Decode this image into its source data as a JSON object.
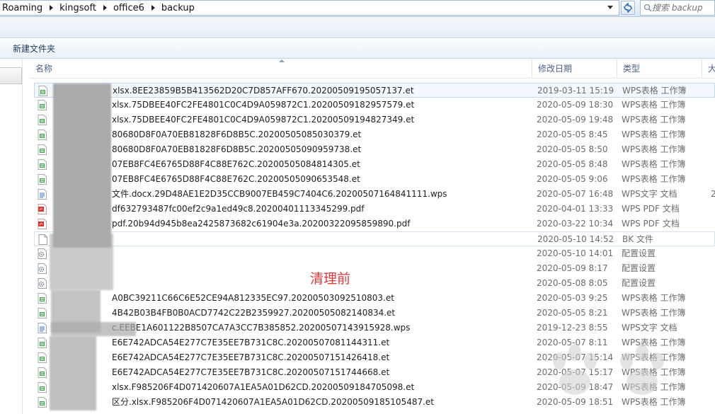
{
  "address": {
    "crumbs": [
      "Roaming",
      "kingsoft",
      "office6",
      "backup"
    ],
    "search_placeholder": "搜索 backup"
  },
  "toolbar": {
    "new_folder_label": "新建文件夹"
  },
  "columns": {
    "name": "名称",
    "date": "修改日期",
    "type": "类型",
    "size": "大"
  },
  "annotation": "清理前",
  "colors": {
    "annotation": "#e23a3a",
    "selection": "#f3f8fe",
    "header_text": "#4d6185"
  },
  "files": [
    {
      "icon": "wps-et-icon",
      "name": "xlsx.8EE23859B5B413562D20C7D857AFF670.20200509195057137.et",
      "date": "2019-03-11 15:19",
      "type": "WPS表格 工作簿",
      "size": ""
    },
    {
      "icon": "wps-et-icon",
      "name": "xlsx.75DBEE40FC2FE4801C0C4D9A059872C1.20200509182957579.et",
      "date": "2020-05-09 18:30",
      "type": "WPS表格 工作簿",
      "size": ""
    },
    {
      "icon": "wps-et-icon",
      "name": "xlsx.75DBEE40FC2FE4801C0C4D9A059872C1.20200509194827349.et",
      "date": "2020-05-09 19:48",
      "type": "WPS表格 工作簿",
      "size": ""
    },
    {
      "icon": "wps-et-icon",
      "name": "80680D8F0A70EB81828F6D8B5C.20200505085030379.et",
      "date": "2020-05-05 8:45",
      "type": "WPS表格 工作簿",
      "size": ""
    },
    {
      "icon": "wps-et-icon",
      "name": "80680D8F0A70EB81828F6D8B5C.20200505090959738.et",
      "date": "2020-05-05 8:50",
      "type": "WPS表格 工作簿",
      "size": ""
    },
    {
      "icon": "wps-et-icon",
      "name": "07EB8FC4E6765D88F4C88E762C.20200505084814305.et",
      "date": "2020-05-05 8:48",
      "type": "WPS表格 工作簿",
      "size": ""
    },
    {
      "icon": "wps-et-icon",
      "name": "07EB8FC4E6765D88F4C88E762C.20200505090653548.et",
      "date": "2020-05-05 9:06",
      "type": "WPS表格 工作簿",
      "size": ""
    },
    {
      "icon": "wps-doc-icon",
      "name": "文件.docx.29D48AE1E2D35CCB9007EB459C7404C6.20200507164841111.wps",
      "date": "2020-05-07 16:48",
      "type": "WPS文字 文档",
      "size": "2"
    },
    {
      "icon": "pdf-icon",
      "name": "df632793487fc00ef2c9a1ed49c8.20200401113345299.pdf",
      "date": "2020-04-01 13:33",
      "type": "WPS PDF 文档",
      "size": ""
    },
    {
      "icon": "pdf-icon",
      "name": "pdf.20b94d945b8ea2425873682c61904e3a.20200322095859890.pdf",
      "date": "2020-03-22 10:34",
      "type": "WPS PDF 文档",
      "size": ""
    },
    {
      "icon": "blank-file-icon",
      "name": "",
      "date": "2020-05-10 14:52",
      "type": "BK 文件",
      "size": ""
    },
    {
      "icon": "config-icon",
      "name": "",
      "date": "2020-05-10 14:01",
      "type": "配置设置",
      "size": ""
    },
    {
      "icon": "config-icon",
      "name": "",
      "date": "2020-05-09 8:17",
      "type": "配置设置",
      "size": ""
    },
    {
      "icon": "config-icon",
      "name": "",
      "date": "2020-05-08 8:05",
      "type": "配置设置",
      "size": ""
    },
    {
      "icon": "wps-et-icon",
      "name": "A0BC39211C66C6E52CE94A812335EC97.20200503092510803.et",
      "date": "2020-05-03 9:25",
      "type": "WPS表格 工作簿",
      "size": ""
    },
    {
      "icon": "wps-et-icon",
      "name": "4B42B03B4FB0B0ACD7742C22B2359927.20200505082140834.et",
      "date": "2020-05-05 8:21",
      "type": "WPS表格 工作簿",
      "size": ""
    },
    {
      "icon": "wps-doc-icon",
      "name": "c.EEBE1A601122B8507CA7A3CC7B385852.20200507143915928.wps",
      "date": "2019-12-23 8:55",
      "type": "WPS文字 文档",
      "size": ""
    },
    {
      "icon": "wps-et-icon",
      "name": "E6E742ADCA54E277C7E35EE7B731C8C.20200507081144311.et",
      "date": "2020-05-07 8:11",
      "type": "WPS表格 工作簿",
      "size": ""
    },
    {
      "icon": "wps-et-icon",
      "name": "E6E742ADCA54E277C7E35EE7B731C8C.20200507151426418.et",
      "date": "2020-05-07 15:14",
      "type": "WPS表格 工作簿",
      "size": ""
    },
    {
      "icon": "wps-et-icon",
      "name": "E6E742ADCA54E277C7E35EE7B731C8C.20200507151744668.et",
      "date": "2020-05-07 15:17",
      "type": "WPS表格 工作簿",
      "size": ""
    },
    {
      "icon": "wps-et-icon",
      "name": "xlsx.F985206F4D071420607A1EA5A01D62CD.20200509184705098.et",
      "date": "2020-05-09 18:47",
      "type": "WPS表格 工作簿",
      "size": ""
    },
    {
      "icon": "wps-et-icon",
      "name": "区分.xlsx.F985206F4D071420607A1EA5A01D62CD.20200509185105487.et",
      "date": "2020-05-09 18:51",
      "type": "WPS表格 工作簿",
      "size": ""
    }
  ]
}
